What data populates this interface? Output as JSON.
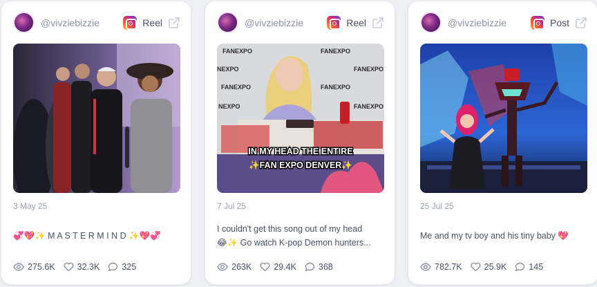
{
  "cards": [
    {
      "handle": "@vivziebizzie",
      "type_label": "Reel",
      "date": "3 May 25",
      "caption_lines": [
        "💞💖✨ M A S T E R M I N D ✨💖💞"
      ],
      "stats": {
        "views": "275.6K",
        "likes": "32.3K",
        "comments": "325"
      },
      "icons": {
        "platform": "instagram-icon",
        "external": "external-link-icon",
        "views": "eye-icon",
        "likes": "heart-icon",
        "comments": "comment-icon"
      }
    },
    {
      "handle": "@vivziebizzie",
      "type_label": "Reel",
      "date": "7 Jul 25",
      "overlay_text": [
        "IN MY HEAD THE ENTIRE",
        "✨FAN EXPO DENVER✨"
      ],
      "caption_lines": [
        "I couldn't get this song out of my head",
        "😂✨ Go watch K-pop Demon hunters..."
      ],
      "stats": {
        "views": "263K",
        "likes": "29.4K",
        "comments": "368"
      },
      "icons": {
        "platform": "instagram-icon",
        "external": "external-link-icon",
        "views": "eye-icon",
        "likes": "heart-icon",
        "comments": "comment-icon"
      }
    },
    {
      "handle": "@vivziebizzie",
      "type_label": "Post",
      "date": "25 Jul 25",
      "caption_lines": [
        "Me and my tv boy and his tiny baby 💖"
      ],
      "stats": {
        "views": "782.7K",
        "likes": "25.9K",
        "comments": "145"
      },
      "icons": {
        "platform": "instagram-icon",
        "external": "external-link-icon",
        "views": "eye-icon",
        "likes": "heart-icon",
        "comments": "comment-icon"
      }
    }
  ],
  "colors": {
    "card_bg": "#ffffff",
    "page_bg": "#eef0f4",
    "muted_text": "#9aa0b1",
    "body_text": "#4a5164",
    "icon_stroke": "#8c93a6"
  }
}
